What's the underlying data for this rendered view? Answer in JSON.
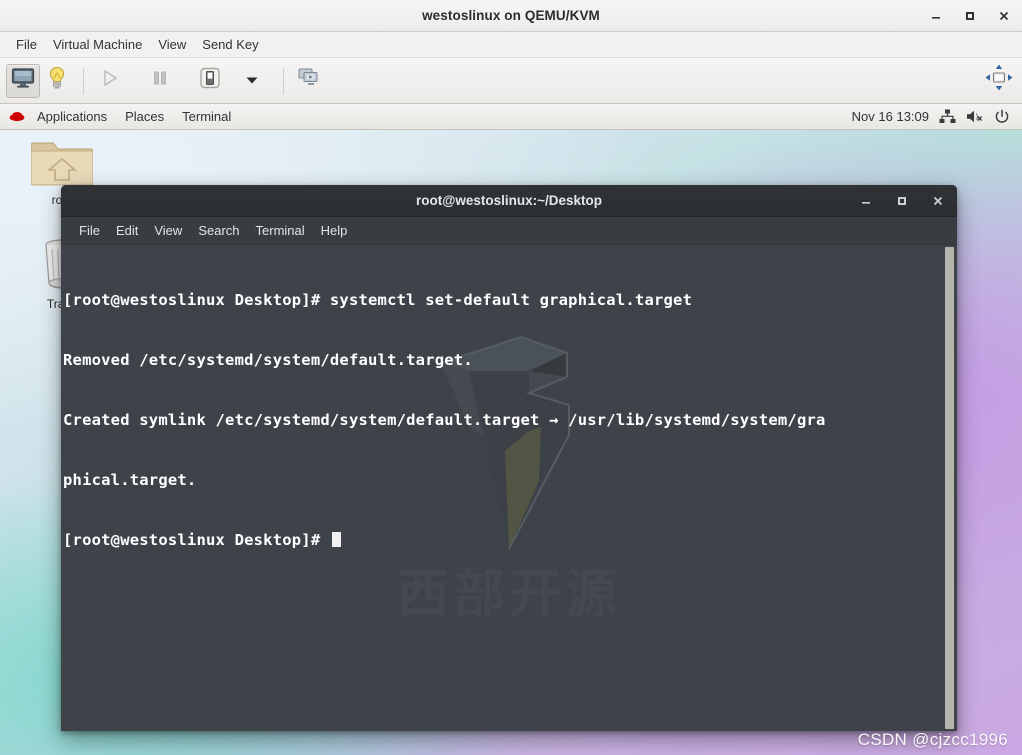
{
  "vm_window": {
    "title": "westoslinux on QEMU/KVM",
    "controls": [
      {
        "name": "minimize",
        "glyph": "minimize"
      },
      {
        "name": "maximize",
        "glyph": "maximize"
      },
      {
        "name": "close",
        "glyph": "close"
      }
    ],
    "menus": [
      "File",
      "Virtual Machine",
      "View",
      "Send Key"
    ],
    "toolbar": [
      {
        "name": "console-view-button",
        "icon": "monitor-icon",
        "state": "active"
      },
      {
        "name": "show-details-button",
        "icon": "lightbulb-icon",
        "state": "normal"
      },
      {
        "name": "run-button",
        "icon": "play-icon",
        "state": "disabled"
      },
      {
        "name": "pause-button",
        "icon": "pause-icon",
        "state": "disabled"
      },
      {
        "name": "shutdown-button",
        "icon": "power-switch-icon",
        "state": "normal"
      },
      {
        "name": "shutdown-menu-button",
        "icon": "chevron-down-icon",
        "state": "normal"
      },
      {
        "name": "snapshots-button",
        "icon": "snapshots-icon",
        "state": "normal"
      },
      {
        "name": "fullscreen-button",
        "icon": "fullscreen-arrows-icon",
        "state": "normal"
      }
    ]
  },
  "gnome_panel": {
    "logo_icon": "redhat-fedora-icon",
    "items": [
      "Applications",
      "Places",
      "Terminal"
    ],
    "clock": "Nov 16  13:09",
    "tray": [
      {
        "name": "network-icon",
        "icon": "network-wired-icon"
      },
      {
        "name": "volume-muted-icon",
        "icon": "speaker-muted-icon"
      },
      {
        "name": "power-icon",
        "icon": "power-icon"
      }
    ]
  },
  "desktop": {
    "icons": [
      {
        "name": "home-folder-icon",
        "icon": "folder-home-icon",
        "label": "root"
      },
      {
        "name": "trash-icon",
        "icon": "trash-can-icon",
        "label": "Trash"
      }
    ],
    "watermark": "CSDN @cjzcc1996"
  },
  "terminal": {
    "title": "root@westoslinux:~/Desktop",
    "controls": [
      {
        "name": "minimize",
        "glyph": "minimize"
      },
      {
        "name": "maximize",
        "glyph": "maximize"
      },
      {
        "name": "close",
        "glyph": "close"
      }
    ],
    "menus": [
      "File",
      "Edit",
      "View",
      "Search",
      "Terminal",
      "Help"
    ],
    "wallpaper_text": "西部开源",
    "lines": [
      "[root@westoslinux Desktop]# systemctl set-default graphical.target",
      "Removed /etc/systemd/system/default.target.",
      "Created symlink /etc/systemd/system/default.target → /usr/lib/systemd/system/gra",
      "phical.target.",
      "[root@westoslinux Desktop]# "
    ],
    "prompt_last": "[root@westoslinux Desktop]# ",
    "cursor": "block"
  },
  "colors": {
    "terminal_bg": "#3d4348",
    "terminal_titlebar": "#2f3336",
    "terminal_menubar": "#383d41",
    "terminal_text": "#ffffff",
    "panel_bg": "#f1efed",
    "accent_blue": "#3465a4",
    "redhat_red": "#cc0000"
  }
}
